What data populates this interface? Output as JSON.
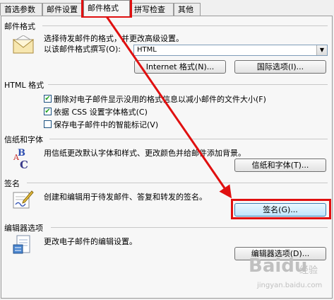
{
  "tabs": [
    "首选参数",
    "邮件设置",
    "邮件格式",
    "拼写检查",
    "其他"
  ],
  "mail_format": {
    "title": "邮件格式",
    "description": "选择待发邮件的格式，并更改高级设置。",
    "compose_label": "以该邮件格式撰写(O):",
    "compose_value": "HTML",
    "internet_button": "Internet 格式(N)...",
    "intl_button": "国际选项(I)..."
  },
  "html_format": {
    "title": "HTML 格式",
    "options": [
      {
        "label": "删除对电子邮件显示没用的格式信息以减小邮件的文件大小(F)",
        "checked": true
      },
      {
        "label": "依据 CSS 设置字体格式(C)",
        "checked": true
      },
      {
        "label": "保存电子邮件中的智能标记(V)",
        "checked": false
      }
    ]
  },
  "stationery": {
    "title": "信纸和字体",
    "description": "用信纸更改默认字体和样式、更改颜色并给邮件添加背景。",
    "button": "信纸和字体(T)..."
  },
  "signature": {
    "title": "签名",
    "description": "创建和编辑用于待发邮件、答复和转发的签名。",
    "button": "签名(G)..."
  },
  "editor": {
    "title": "编辑器选项",
    "description": "更改电子邮件的编辑设置。",
    "button": "编辑器选项(D)..."
  },
  "watermark": {
    "brand": "Baidu",
    "sub": "经验",
    "url": "jingyan.baidu.com"
  },
  "colors": {
    "annotation": "#e01010"
  }
}
